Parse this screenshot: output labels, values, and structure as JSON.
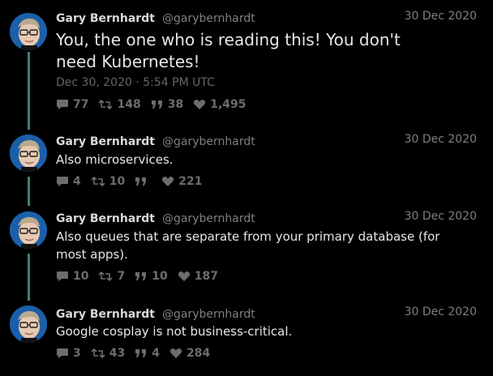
{
  "tweets": [
    {
      "name": "Gary Bernhardt",
      "handle": "@garybernhardt",
      "date": "30 Dec 2020",
      "text": "You, the one who is reading this! You don't need Kubernetes!",
      "timestamp": "Dec 30, 2020 · 5:54 PM UTC",
      "replies": "77",
      "retweets": "148",
      "quotes": "38",
      "likes": "1,495"
    },
    {
      "name": "Gary Bernhardt",
      "handle": "@garybernhardt",
      "date": "30 Dec 2020",
      "text": "Also microservices.",
      "replies": "4",
      "retweets": "10",
      "quotes": "",
      "likes": "221"
    },
    {
      "name": "Gary Bernhardt",
      "handle": "@garybernhardt",
      "date": "30 Dec 2020",
      "text": "Also queues that are separate from your primary database (for most apps).",
      "replies": "10",
      "retweets": "7",
      "quotes": "10",
      "likes": "187"
    },
    {
      "name": "Gary Bernhardt",
      "handle": "@garybernhardt",
      "date": "30 Dec 2020",
      "text": "Google cosplay is not business-critical.",
      "replies": "3",
      "retweets": "43",
      "quotes": "4",
      "likes": "284"
    }
  ],
  "icons": {
    "reply": "comment-icon",
    "retweet": "retweet-icon",
    "quote": "quote-icon",
    "like": "heart-icon"
  },
  "colors": {
    "background": "#000000",
    "thread_line": "#3f7f7a",
    "muted": "#7f7f7f"
  }
}
